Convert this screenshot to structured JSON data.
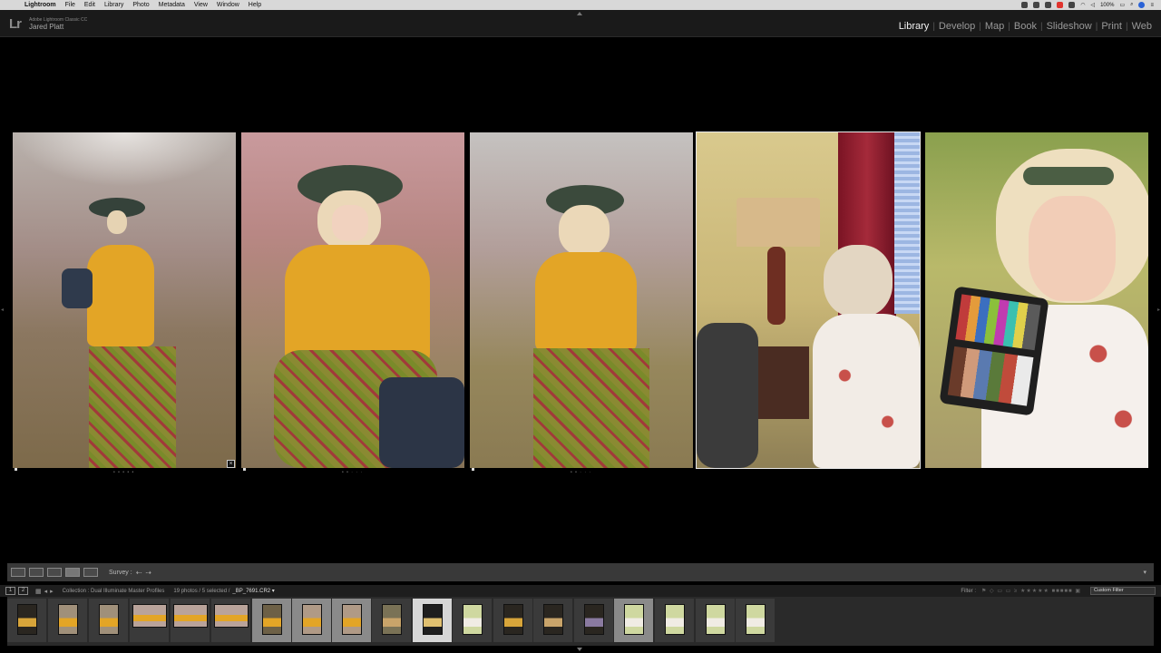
{
  "menubar": {
    "apple_icon": "apple-icon",
    "app": "Lightroom",
    "items": [
      "File",
      "Edit",
      "Library",
      "Photo",
      "Metadata",
      "View",
      "Window",
      "Help"
    ],
    "battery": "100%"
  },
  "identity": {
    "logo": "Lr",
    "app_name": "Adobe Lightroom Classic CC",
    "user": "Jared Platt"
  },
  "modules": [
    "Library",
    "Develop",
    "Map",
    "Book",
    "Slideshow",
    "Print",
    "Web"
  ],
  "active_module": "Library",
  "toolbar": {
    "view_icons": [
      "grid-view-icon",
      "loupe-view-icon",
      "compare-view-icon",
      "survey-view-icon",
      "people-view-icon"
    ],
    "survey_label": "Survey :",
    "prev": "⇠",
    "next": "⇢"
  },
  "filmstrip_header": {
    "monitor1": "1",
    "monitor2": "2",
    "collection": "Collection : Dual Illuminate Master Profiles",
    "counts": "19 photos / 5 selected /",
    "filename": "_BP_7691.CR2 ▾",
    "filter_label": "Filter :",
    "filter_value": "Custom Filter"
  },
  "survey_photos": [
    {
      "id": "survey-photo-1",
      "stars": "• • • • •",
      "selected": false
    },
    {
      "id": "survey-photo-2",
      "stars": "• • · · ·",
      "selected": false
    },
    {
      "id": "survey-photo-3",
      "stars": "• • · · ·",
      "selected": false
    },
    {
      "id": "survey-photo-4",
      "stars": "",
      "selected": true
    },
    {
      "id": "survey-photo-5",
      "stars": "",
      "selected": false
    }
  ],
  "filmstrip_count": 19,
  "colors": {
    "accent": "#f2f2f2",
    "sweater": "#e3a526",
    "hat": "#3b4a3c"
  }
}
